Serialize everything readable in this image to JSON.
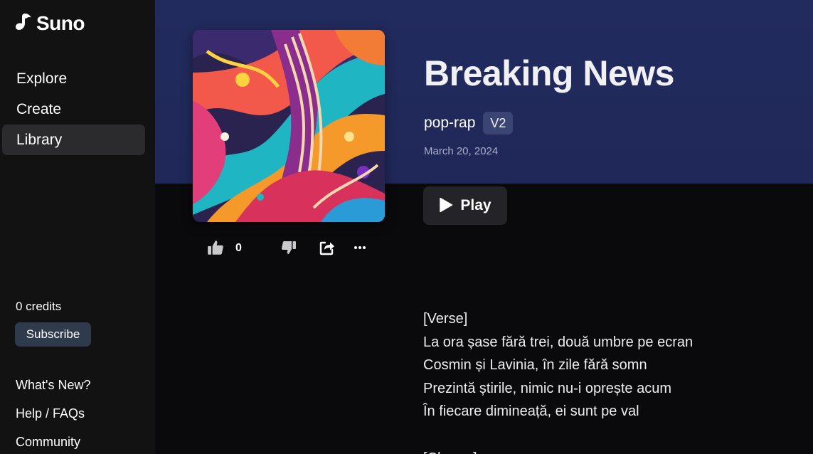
{
  "sidebar": {
    "logo_text": "Suno",
    "nav": [
      {
        "label": "Explore",
        "active": false
      },
      {
        "label": "Create",
        "active": false
      },
      {
        "label": "Library",
        "active": true
      }
    ],
    "credits": "0 credits",
    "subscribe_label": "Subscribe",
    "footer_links": [
      "What's New?",
      "Help / FAQs",
      "Community"
    ]
  },
  "song": {
    "title": "Breaking News",
    "genre": "pop-rap",
    "version": "V2",
    "date": "March 20, 2024",
    "play_label": "Play",
    "like_count": "0"
  },
  "icons": {
    "logo": "suno-logo-icon",
    "like": "thumbs-up-icon",
    "dislike": "thumbs-down-icon",
    "share": "share-icon",
    "more": "more-horizontal-icon",
    "play": "play-icon"
  },
  "lyrics": [
    "[Verse]",
    "La ora șase fără trei, două umbre pe ecran",
    "Cosmin și Lavinia, în zile fără somn",
    "Prezintă știrile, nimic nu-i oprește acum",
    "În fiecare dimineață, ei sunt pe val",
    "",
    "[Chorus]"
  ],
  "colors": {
    "sidebar_bg": "#121212",
    "hero_bg": "#222b5e",
    "main_bg": "#0a0a0d",
    "version_badge": "#3a4573",
    "subscribe_bg": "#2f3a4d",
    "play_bg": "#232328"
  }
}
